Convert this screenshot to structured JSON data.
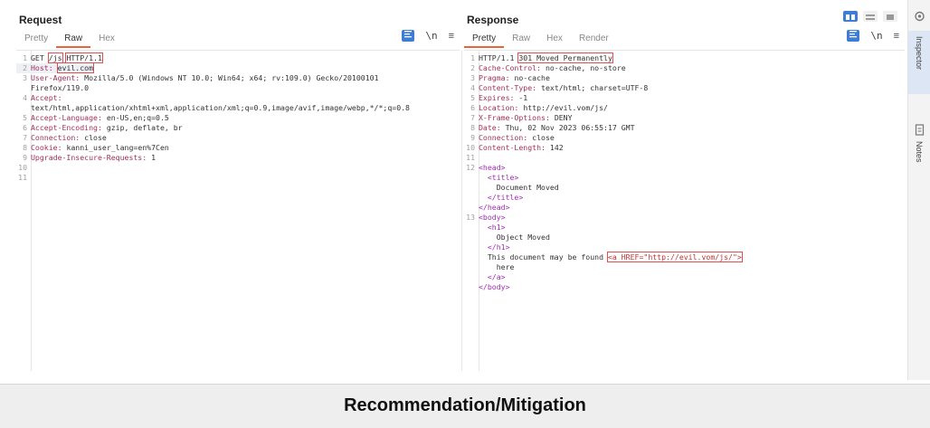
{
  "request": {
    "title": "Request",
    "tabs": [
      "Pretty",
      "Raw",
      "Hex"
    ],
    "active_tab": "Raw",
    "tool_newline": "\\n",
    "tool_menu": "≡",
    "lines": [
      {
        "n": "1",
        "text": "GET /js HTTP/1.1"
      },
      {
        "n": "2",
        "key": "Host:",
        "value": "evil.com"
      },
      {
        "n": "3",
        "key": "User-Agent:",
        "value": "Mozilla/5.0 (Windows NT 10.0; Win64; x64; rv:109.0) Gecko/20100101"
      },
      {
        "n": "",
        "text": "Firefox/119.0"
      },
      {
        "n": "4",
        "key": "Accept:",
        "value": ""
      },
      {
        "n": "",
        "text": "text/html,application/xhtml+xml,application/xml;q=0.9,image/avif,image/webp,*/*;q=0.8"
      },
      {
        "n": "5",
        "key": "Accept-Language:",
        "value": "en-US,en;q=0.5"
      },
      {
        "n": "6",
        "key": "Accept-Encoding:",
        "value": "gzip, deflate, br"
      },
      {
        "n": "7",
        "key": "Connection:",
        "value": "close"
      },
      {
        "n": "8",
        "key": "Cookie:",
        "value": "kanni_user_lang=en%7Cen"
      },
      {
        "n": "9",
        "key": "Upgrade-Insecure-Requests:",
        "value": "1"
      },
      {
        "n": "10",
        "text": ""
      },
      {
        "n": "11",
        "text": ""
      }
    ]
  },
  "response": {
    "title": "Response",
    "tabs": [
      "Pretty",
      "Raw",
      "Hex",
      "Render"
    ],
    "active_tab": "Pretty",
    "tool_newline": "\\n",
    "tool_menu": "≡",
    "lines": [
      {
        "n": "1",
        "text": "HTTP/1.1 301 Moved Permanently"
      },
      {
        "n": "2",
        "key": "Cache-Control:",
        "value": "no-cache, no-store"
      },
      {
        "n": "3",
        "key": "Pragma:",
        "value": "no-cache"
      },
      {
        "n": "4",
        "key": "Content-Type:",
        "value": "text/html; charset=UTF-8"
      },
      {
        "n": "5",
        "key": "Expires:",
        "value": "-1"
      },
      {
        "n": "6",
        "key": "Location:",
        "value": "http://evil.vom/js/"
      },
      {
        "n": "7",
        "key": "X-Frame-Options:",
        "value": "DENY"
      },
      {
        "n": "8",
        "key": "Date:",
        "value": "Thu, 02 Nov 2023 06:55:17 GMT"
      },
      {
        "n": "9",
        "key": "Connection:",
        "value": "close"
      },
      {
        "n": "10",
        "key": "Content-Length:",
        "value": "142"
      },
      {
        "n": "11",
        "text": ""
      },
      {
        "n": "12",
        "tag": "<head>"
      },
      {
        "n": "",
        "indent": "  ",
        "tag": "<title>"
      },
      {
        "n": "",
        "indent": "    ",
        "text": "Document Moved"
      },
      {
        "n": "",
        "indent": "  ",
        "tag": "</title>"
      },
      {
        "n": "",
        "tag": "</head>"
      },
      {
        "n": "13",
        "tag": "<body>"
      },
      {
        "n": "",
        "indent": "  ",
        "tag": "<h1>"
      },
      {
        "n": "",
        "indent": "    ",
        "text": "Object Moved"
      },
      {
        "n": "",
        "indent": "  ",
        "tag": "</h1>"
      },
      {
        "n": "",
        "indent": "  ",
        "text": "This document may be found ",
        "link": "<a HREF=\"http://evil.vom/js/\">"
      },
      {
        "n": "",
        "indent": "    ",
        "text": "here"
      },
      {
        "n": "",
        "indent": "  ",
        "tag": "</a>"
      },
      {
        "n": "",
        "tag": "</body>"
      }
    ]
  },
  "sidebar": {
    "items": [
      {
        "label": "Inspector",
        "icon": "settings-icon"
      },
      {
        "label": "Notes",
        "icon": "notes-icon"
      }
    ]
  },
  "footer": {
    "title": "Recommendation/Mitigation"
  },
  "colors": {
    "accent": "#e8643c",
    "tool_blue": "#3d7dd6",
    "highlight_box": "#e05050",
    "header_key": "#a0305a",
    "html_tag": "#a02cb0"
  }
}
